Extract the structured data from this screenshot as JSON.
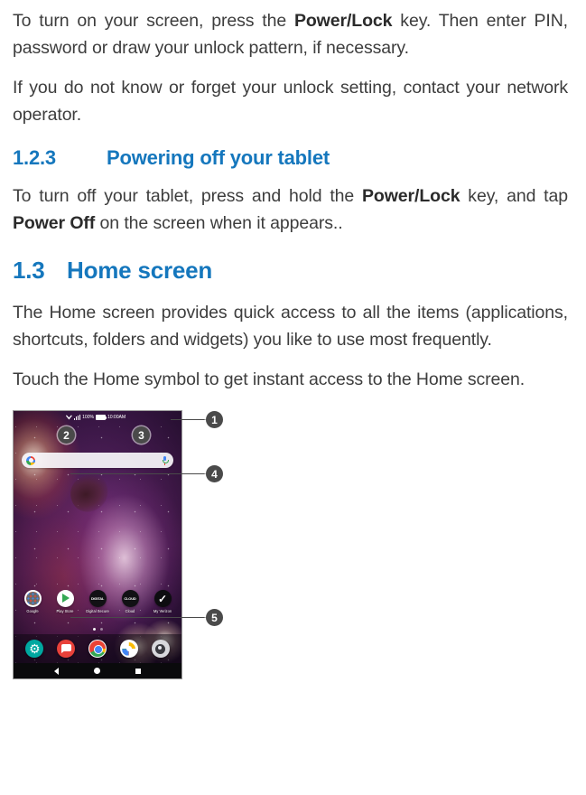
{
  "document": {
    "paragraphs": [
      {
        "id": "p1",
        "segments": [
          {
            "text": "To turn on your screen, press the ",
            "bold": false
          },
          {
            "text": "Power/Lock",
            "bold": true
          },
          {
            "text": " key. Then enter PIN, password or draw your unlock pattern, if necessary.",
            "bold": false
          }
        ]
      },
      {
        "id": "p2",
        "segments": [
          {
            "text": "If you do not know or forget your unlock setting, contact your network operator.",
            "bold": false
          }
        ]
      }
    ],
    "heading_1_2_3": {
      "number": "1.2.3",
      "title": "Powering off your tablet"
    },
    "paragraph_power_off": {
      "segments": [
        {
          "text": "To turn off your tablet, press and hold the ",
          "bold": false
        },
        {
          "text": "Power/Lock",
          "bold": true
        },
        {
          "text": " key, and tap ",
          "bold": false
        },
        {
          "text": "Power Off",
          "bold": true
        },
        {
          "text": " on the screen when it appears..",
          "bold": false
        }
      ]
    },
    "heading_1_3": {
      "number": "1.3",
      "title": "Home screen"
    },
    "paragraph_home_1": {
      "text": "The Home screen provides quick access to all the items (applications, shortcuts, folders and widgets) you like to use most frequently."
    },
    "paragraph_home_2": {
      "text": "Touch the Home symbol to get instant access to the Home screen."
    }
  },
  "colors": {
    "heading_blue": "#1577bd",
    "body_text": "#3d3d3d",
    "callout_fill": "#4a4a4a",
    "callout_text": "#ffffff"
  },
  "figure": {
    "callouts": [
      {
        "number": "1",
        "target": "status-bar"
      },
      {
        "number": "2",
        "target": "google-search-logo"
      },
      {
        "number": "3",
        "target": "voice-search-mic"
      },
      {
        "number": "4",
        "target": "google-search-bar"
      },
      {
        "number": "5",
        "target": "favorites-dock"
      }
    ],
    "status_bar": {
      "battery_percent": "100%",
      "time": "10:00AM"
    },
    "search_bar": {
      "placeholder": "",
      "left_icon": "google-g-icon",
      "right_icon": "microphone-icon"
    },
    "apps": [
      {
        "label": "Google",
        "icon": "google-icon"
      },
      {
        "label": "Play Store",
        "icon": "play-store-icon"
      },
      {
        "label": "Digital Secure",
        "icon": "digital-secure-icon",
        "icon_text": "DIGITAL"
      },
      {
        "label": "Cloud",
        "icon": "cloud-icon",
        "icon_text": "CLOUD"
      },
      {
        "label": "My Verizon",
        "icon": "my-verizon-icon"
      }
    ],
    "page_indicator": {
      "pages": 2,
      "active": 1
    },
    "dock": [
      {
        "name": "Settings",
        "icon": "settings-gear-icon"
      },
      {
        "name": "Messages",
        "icon": "messages-icon"
      },
      {
        "name": "Chrome",
        "icon": "chrome-icon"
      },
      {
        "name": "Photos",
        "icon": "photos-icon"
      },
      {
        "name": "Camera",
        "icon": "camera-icon"
      }
    ],
    "nav_bar": [
      {
        "name": "Back",
        "icon": "back-triangle-icon"
      },
      {
        "name": "Home",
        "icon": "home-circle-icon"
      },
      {
        "name": "Recents",
        "icon": "recents-square-icon"
      }
    ]
  }
}
